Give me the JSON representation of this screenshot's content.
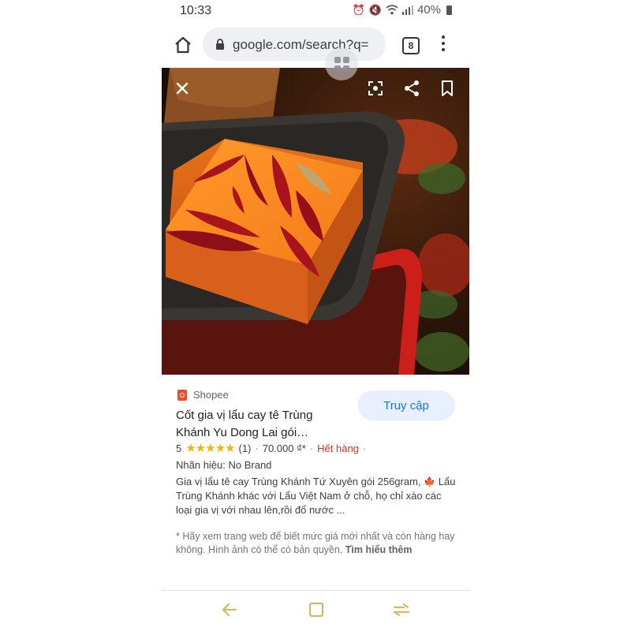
{
  "status_bar": {
    "time": "10:33",
    "battery": "40%",
    "icons": [
      "alarm-icon",
      "mute-icon",
      "wifi-icon",
      "signal-icon",
      "battery-icon"
    ]
  },
  "browser": {
    "url": "google.com/search?q=",
    "tab_count": "8",
    "icons": [
      "home-icon",
      "lock-icon",
      "tabs-icon",
      "more-vert-icon"
    ]
  },
  "image_viewer": {
    "icons": [
      "close-icon",
      "lens-icon",
      "share-icon",
      "bookmark-icon",
      "drag-handle-icon"
    ],
    "colors": {
      "broth": "#f57c1f",
      "chili": "#a8141c",
      "pot": "#cc1f1a",
      "background": "#2a1508"
    }
  },
  "result": {
    "source": "Shopee",
    "visit_label": "Truy cập",
    "title": "Cốt gia vị lẩu cay tê Trùng Khánh Yu Dong Lai gói…",
    "rating_value": "5",
    "stars": "★★★★★",
    "review_count": "(1)",
    "price": "70.000 ₫*",
    "stock_status": "Hết hàng",
    "brand": "Nhãn hiệu: No Brand",
    "description_1": "Gia vị lẩu tê cay Trùng Khánh Tứ Xuyên gói 256gram,",
    "description_icon": "🍁",
    "description_2": "Lẩu Trùng Khánh khác với Lẩu Việt Nam ở chỗ, họ chỉ xào các loại gia vị với nhau lên,rồi đổ nước ...",
    "disclaimer": "* Hãy xem trang web để biết mức giá mới nhất và còn hàng hay không. Hình ảnh có thể có bản quyền.",
    "learn_more": "Tìm hiểu thêm",
    "colors": {
      "accent": "#1a73e8",
      "stock_red": "#d93025",
      "star": "#f5b400",
      "shopee": "#ee4d2d"
    }
  },
  "nav_bar": {
    "icons": [
      "back-icon",
      "recents-icon",
      "apps-icon"
    ],
    "color": "#d4b86a"
  }
}
